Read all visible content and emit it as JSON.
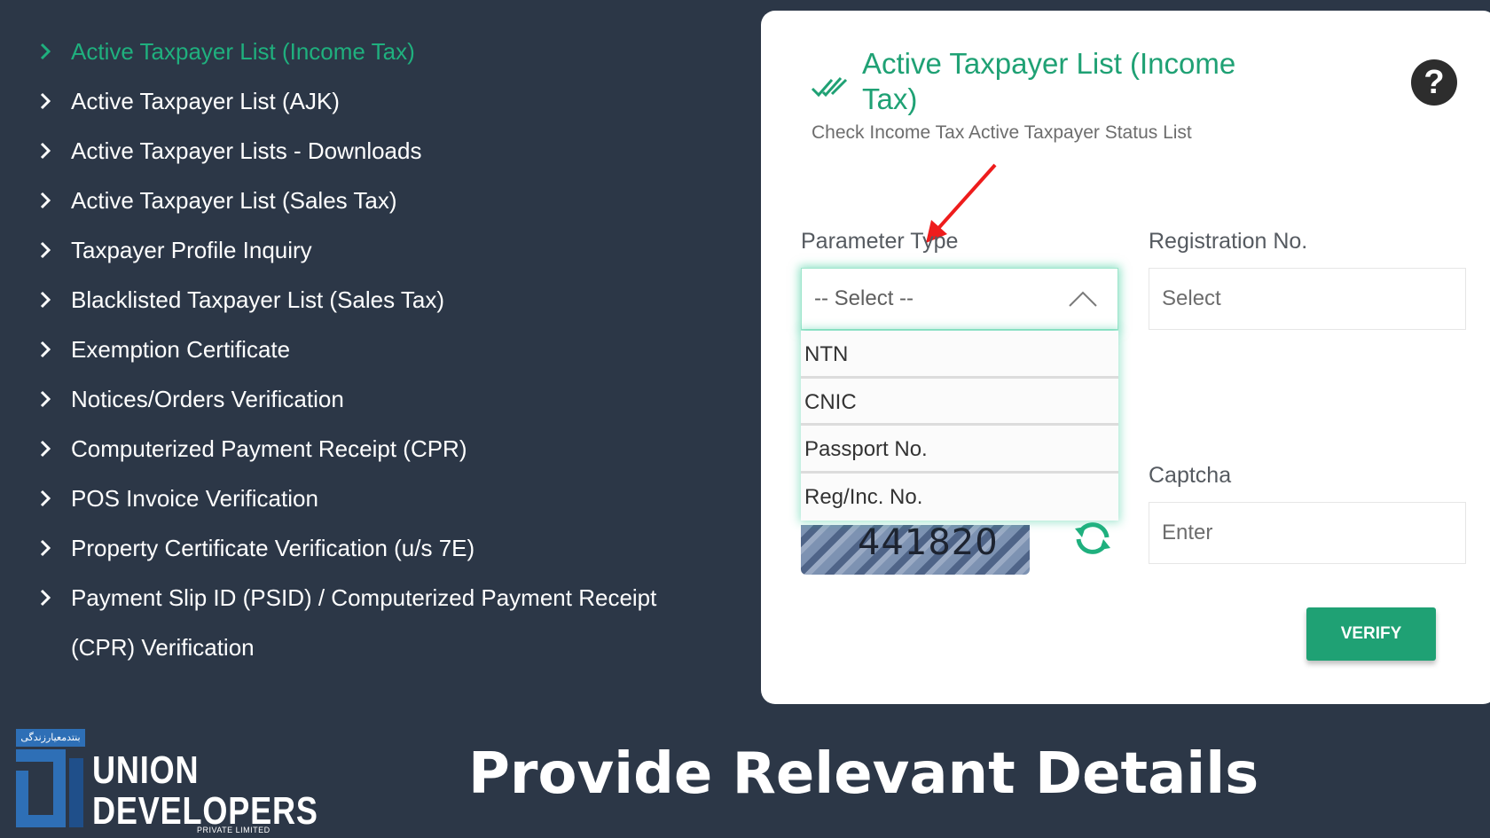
{
  "sidebar": {
    "items": [
      {
        "label": "Active Taxpayer List (Income Tax)"
      },
      {
        "label": "Active Taxpayer List (AJK)"
      },
      {
        "label": "Active Taxpayer Lists - Downloads"
      },
      {
        "label": "Active Taxpayer List (Sales Tax)"
      },
      {
        "label": "Taxpayer Profile Inquiry"
      },
      {
        "label": "Blacklisted Taxpayer List (Sales Tax)"
      },
      {
        "label": "Exemption Certificate"
      },
      {
        "label": "Notices/Orders Verification"
      },
      {
        "label": "Computerized Payment Receipt (CPR)"
      },
      {
        "label": "POS Invoice Verification"
      },
      {
        "label": "Property Certificate Verification (u/s 7E)"
      },
      {
        "label": "Payment Slip ID (PSID) / Computerized Payment Receipt (CPR) Verification"
      }
    ],
    "active_index": 0,
    "active_color": "#1fb07e"
  },
  "card": {
    "title": "Active Taxpayer List (Income Tax)",
    "subtitle": "Check Income Tax Active Taxpayer Status List",
    "icons": {
      "title": "double-check-icon",
      "help": "question-circle-icon",
      "refresh": "refresh-icon"
    },
    "help_glyph": "?",
    "parameter_type": {
      "label": "Parameter Type",
      "selected": "-- Select --",
      "options": [
        "NTN",
        "CNIC",
        "Passport No.",
        "Reg/Inc. No."
      ]
    },
    "registration": {
      "label": "Registration No.",
      "placeholder": "Select"
    },
    "captcha": {
      "label": "Captcha",
      "placeholder": "Enter",
      "code": "441820"
    },
    "verify_label": "VERIFY",
    "accent_color": "#1fa174"
  },
  "footer": {
    "brand_tag": "بنتدمعیارزندگی",
    "brand_name_line1": "UNION",
    "brand_name_line2": "DEVELOPERS",
    "brand_sub": "PRIVATE LIMITED",
    "headline": "Provide Relevant Details"
  }
}
